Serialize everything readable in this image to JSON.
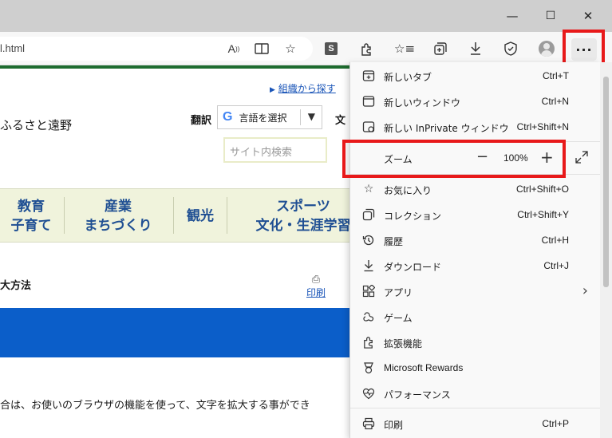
{
  "browser": {
    "address_partial": "l.html",
    "window_buttons": {
      "minimize": "—",
      "maximize": "☐",
      "close": "✕"
    },
    "more_label": "···"
  },
  "page": {
    "org_link": "組織から探す",
    "org_link_arrow": "▶",
    "site_name_partial": "ふるさと遠野",
    "translate_label": "翻訳",
    "translate_select": "言語を選択",
    "text_size_partial": "文",
    "search_placeholder": "サイト内検索",
    "nav": [
      {
        "line1": "教育",
        "line2": "子育て"
      },
      {
        "line1": "産業",
        "line2": "まちづくり"
      },
      {
        "line1": "観光",
        "line2": ""
      },
      {
        "line1": "スポーツ",
        "line2": "文化・生涯学習"
      }
    ],
    "section_title_partial": "大方法",
    "print_label": "印刷",
    "body_text_partial": "合は、お使いのブラウザの機能を使って、文字を拡大する事ができ"
  },
  "menu": {
    "items": [
      {
        "label": "新しいタブ",
        "shortcut": "Ctrl+T",
        "icon": "new-tab-icon"
      },
      {
        "label": "新しいウィンドウ",
        "shortcut": "Ctrl+N",
        "icon": "new-window-icon"
      },
      {
        "label": "新しい InPrivate ウィンドウ",
        "shortcut": "Ctrl+Shift+N",
        "icon": "inprivate-icon"
      }
    ],
    "zoom": {
      "label": "ズーム",
      "minus": "−",
      "value": "100%",
      "plus": "+"
    },
    "items2": [
      {
        "label": "お気に入り",
        "shortcut": "Ctrl+Shift+O",
        "icon": "favorites-icon"
      },
      {
        "label": "コレクション",
        "shortcut": "Ctrl+Shift+Y",
        "icon": "collections-icon"
      },
      {
        "label": "履歴",
        "shortcut": "Ctrl+H",
        "icon": "history-icon"
      },
      {
        "label": "ダウンロード",
        "shortcut": "Ctrl+J",
        "icon": "download-icon"
      },
      {
        "label": "アプリ",
        "shortcut": "",
        "icon": "apps-icon"
      },
      {
        "label": "ゲーム",
        "shortcut": "",
        "icon": "games-icon"
      },
      {
        "label": "拡張機能",
        "shortcut": "",
        "icon": "extensions-icon"
      },
      {
        "label": "Microsoft Rewards",
        "shortcut": "",
        "icon": "rewards-icon"
      },
      {
        "label": "パフォーマンス",
        "shortcut": "",
        "icon": "performance-icon"
      }
    ],
    "print": {
      "label": "印刷",
      "shortcut": "Ctrl+P"
    },
    "apps_arrow": "›"
  },
  "colors": {
    "highlight": "#e8191a",
    "nav_text": "#1f4f93",
    "blue_bar": "#0b5ec9"
  }
}
